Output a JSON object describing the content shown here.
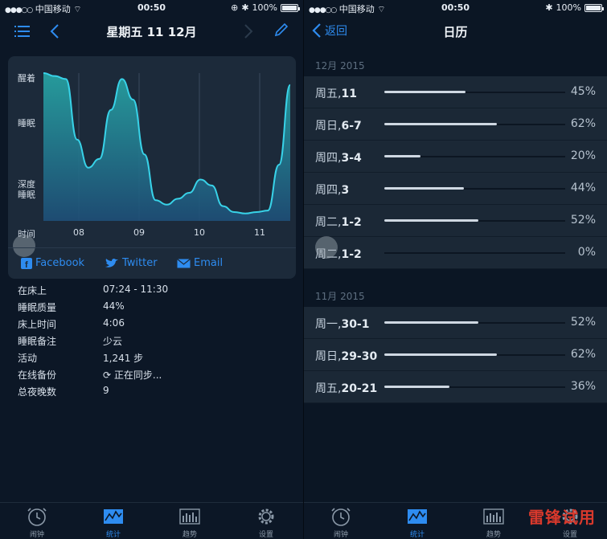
{
  "status": {
    "carrier": "中国移动",
    "time": "00:50",
    "battery": "100%"
  },
  "left": {
    "nav": {
      "title": "星期五 11 12月"
    },
    "chart_data": {
      "type": "area",
      "ylabels": [
        "醒着",
        "睡眠",
        "深度\n睡眠"
      ],
      "xlabel": "时间",
      "xticks": [
        "08",
        "09",
        "10",
        "11"
      ],
      "series": [
        {
          "values": [
            1.0,
            0.98,
            0.96,
            0.55,
            0.36,
            0.42,
            0.75,
            0.96,
            0.82,
            0.45,
            0.14,
            0.11,
            0.15,
            0.19,
            0.28,
            0.24,
            0.1,
            0.06,
            0.05,
            0.06,
            0.07,
            0.38,
            0.92
          ]
        }
      ]
    },
    "share": {
      "facebook": "Facebook",
      "twitter": "Twitter",
      "email": "Email"
    },
    "info": [
      {
        "key": "在床上",
        "value": "07:24 - 11:30"
      },
      {
        "key": "睡眠质量",
        "value": "44%"
      },
      {
        "key": "床上时间",
        "value": "4:06"
      },
      {
        "key": "睡眠备注",
        "value": "少云"
      },
      {
        "key": "活动",
        "value": "1,241 步"
      },
      {
        "key": "在线备份",
        "value": "正在同步..."
      },
      {
        "key": "总夜晚数",
        "value": "9"
      }
    ]
  },
  "right": {
    "nav": {
      "back": "返回",
      "title": "日历"
    },
    "sections": [
      {
        "header": "12月 2015",
        "rows": [
          {
            "day": "周五,",
            "date": "11",
            "pct": "45%",
            "value": 0.45
          },
          {
            "day": "周日,",
            "date": "6-7",
            "pct": "62%",
            "value": 0.62
          },
          {
            "day": "周四,",
            "date": "3-4",
            "pct": "20%",
            "value": 0.2
          },
          {
            "day": "周四,",
            "date": "3",
            "pct": "44%",
            "value": 0.44
          },
          {
            "day": "周二,",
            "date": "1-2",
            "pct": "52%",
            "value": 0.52
          },
          {
            "day": "周二,",
            "date": "1-2",
            "pct": "0%",
            "value": 0.0
          }
        ]
      },
      {
        "header": "11月 2015",
        "rows": [
          {
            "day": "周一,",
            "date": "30-1",
            "pct": "52%",
            "value": 0.52
          },
          {
            "day": "周日,",
            "date": "29-30",
            "pct": "62%",
            "value": 0.62
          },
          {
            "day": "周五,",
            "date": "20-21",
            "pct": "36%",
            "value": 0.36
          }
        ]
      }
    ]
  },
  "tabs": [
    "闹钟",
    "统计",
    "趋势",
    "设置"
  ],
  "watermark": "雷锋试用"
}
